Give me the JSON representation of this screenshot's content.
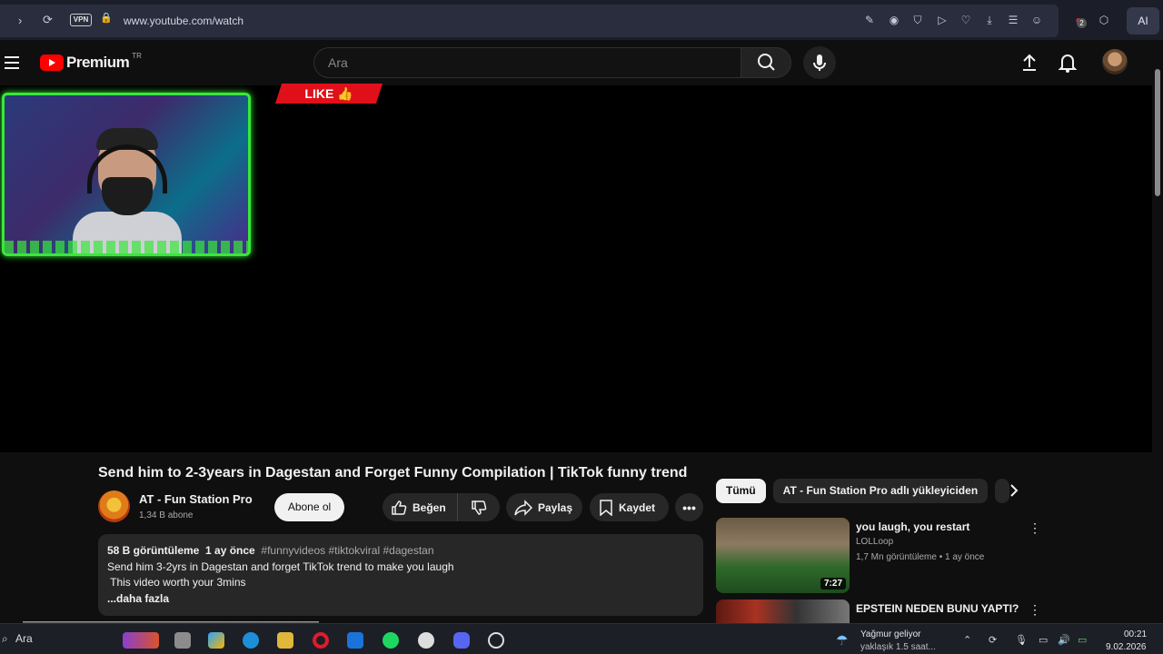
{
  "browser": {
    "url": "www.youtube.com/watch",
    "vpn_label": "VPN",
    "ai_label": "AI",
    "notification_count": "2"
  },
  "header": {
    "logo_text": "Premium",
    "country_code": "TR",
    "search_placeholder": "Ara"
  },
  "player": {
    "like_banner": "LIKE"
  },
  "video": {
    "title": "Send him to 2-3years in Dagestan and Forget Funny Compilation | TikTok funny trend",
    "channel_name": "AT - Fun Station Pro",
    "subscribers": "1,34 B abone",
    "subscribe_label": "Abone ol",
    "like_label": "Beğen",
    "share_label": "Paylaş",
    "save_label": "Kaydet",
    "more_label": "•••"
  },
  "description": {
    "views": "58 B görüntüleme",
    "age": "1 ay önce",
    "tags": "#funnyvideos #tiktokviral #dagestan",
    "line1": "Send him 3-2yrs in Dagestan and forget TikTok trend to make you laugh",
    "line2": " This video worth your 3mins",
    "more": "...daha fazla"
  },
  "chips": [
    {
      "label": "Tümü",
      "active": true
    },
    {
      "label": "AT - Fun Station Pro adlı yükleyiciden",
      "active": false
    },
    {
      "label": "",
      "active": false
    }
  ],
  "recommendations": [
    {
      "title": "you laugh, you restart",
      "channel": "LOLLoop",
      "meta": "1,7 Mn görüntüleme • 1 ay önce",
      "duration": "7:27"
    },
    {
      "title": "EPSTEIN NEDEN BUNU YAPTI?",
      "channel": "",
      "meta": "",
      "duration": ""
    }
  ],
  "taskbar": {
    "search_label": "Ara",
    "weather_title": "Yağmur geliyor",
    "weather_sub": "yaklaşık 1.5 saat...",
    "time": "00:21",
    "date": "9.02.2026"
  },
  "colors": {
    "brand_red": "#ff0000",
    "background": "#0f0f0f",
    "frame_green": "#39e83a"
  }
}
